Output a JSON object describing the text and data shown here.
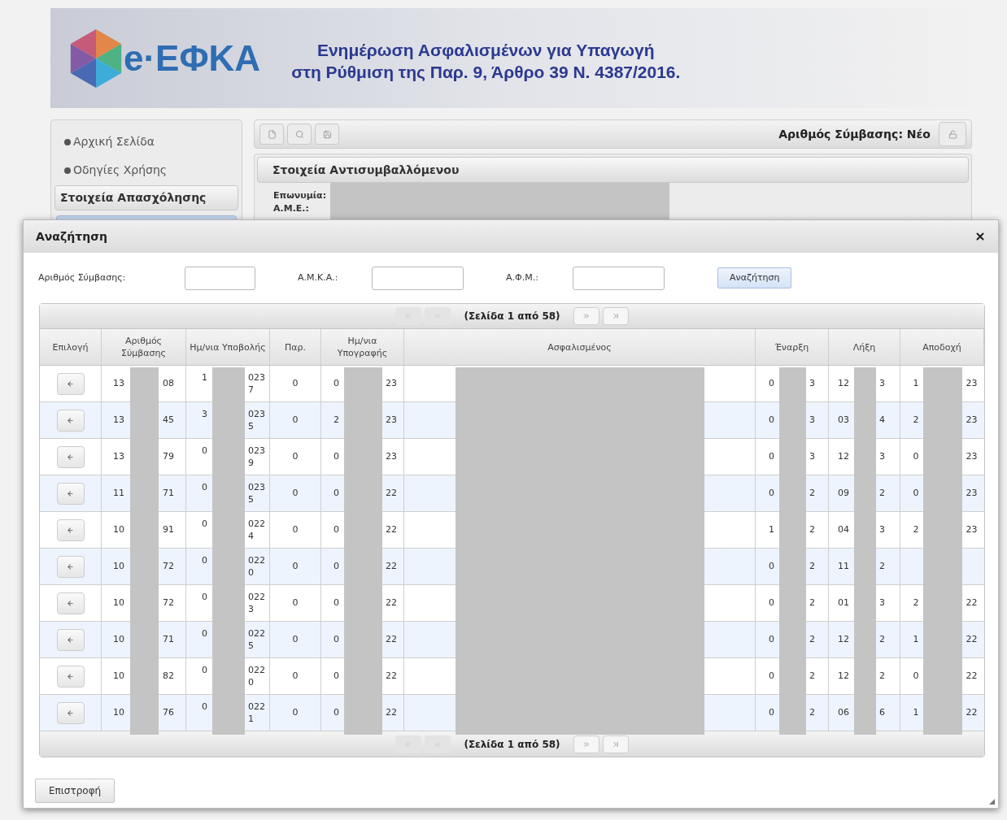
{
  "header": {
    "logo_text": "e·ΕΦΚΑ",
    "title_lines": [
      "Ενημέρωση Ασφαλισμένων για Υπαγωγή",
      "στη Ρύθμιση της Παρ. 9, Άρθρο 39 Ν. 4387/2016."
    ]
  },
  "sidebar": {
    "links": [
      "Αρχική Σελίδα",
      "Οδηγίες Χρήσης"
    ],
    "section": "Στοιχεία Απασχόλησης"
  },
  "toolbar": {
    "contract_label": "Αριθμός Σύμβασης: Νέο"
  },
  "contractor_panel": {
    "title": "Στοιχεία Αντισυμβαλλόμενου",
    "fields": [
      "Επωνυμία:",
      "Α.Μ.Ε.:"
    ]
  },
  "dialog": {
    "title": "Αναζήτηση",
    "filters": [
      {
        "label": "Αριθμός Σύμβασης:"
      },
      {
        "label": "Α.Μ.Κ.Α.:"
      },
      {
        "label": "Α.Φ.Μ.:"
      }
    ],
    "search_button": "Αναζήτηση",
    "pager_top": {
      "label": "(Σελίδα 1 από 58)",
      "buttons": [
        {
          "kind": "first",
          "disabled": true
        },
        {
          "kind": "prev",
          "disabled": true
        },
        {
          "kind": "next",
          "disabled": false
        },
        {
          "kind": "last",
          "disabled": false
        }
      ]
    },
    "columns": [
      "Επιλογή",
      "Αριθμός Σύμβασης",
      "Ημ/νια Υποβολής",
      "Παρ.",
      "Ημ/νια Υπογραφής",
      "Ασφαλισμένος",
      "Έναρξη",
      "Λήξη",
      "Αποδοχή"
    ],
    "rows": [
      {
        "contract": [
          "13",
          "08"
        ],
        "submitted": {
          "line1": [
            "1",
            "023"
          ],
          "line2": "7"
        },
        "par": "0",
        "signed": [
          "0",
          "23"
        ],
        "start": [
          "0",
          "3"
        ],
        "end": [
          "12",
          "3"
        ],
        "accepted": [
          "1",
          "23"
        ]
      },
      {
        "contract": [
          "13",
          "45"
        ],
        "submitted": {
          "line1": [
            "3",
            "023"
          ],
          "line2": "5"
        },
        "par": "0",
        "signed": [
          "2",
          "23"
        ],
        "start": [
          "0",
          "3"
        ],
        "end": [
          "03",
          "4"
        ],
        "accepted": [
          "2",
          "23"
        ]
      },
      {
        "contract": [
          "13",
          "79"
        ],
        "submitted": {
          "line1": [
            "0",
            "023"
          ],
          "line2": "9"
        },
        "par": "0",
        "signed": [
          "0",
          "23"
        ],
        "start": [
          "0",
          "3"
        ],
        "end": [
          "12",
          "3"
        ],
        "accepted": [
          "0",
          "23"
        ]
      },
      {
        "contract": [
          "11",
          "71"
        ],
        "submitted": {
          "line1": [
            "0",
            "023"
          ],
          "line2": "5"
        },
        "par": "0",
        "signed": [
          "0",
          "22"
        ],
        "start": [
          "0",
          "2"
        ],
        "end": [
          "09",
          "2"
        ],
        "accepted": [
          "0",
          "23"
        ]
      },
      {
        "contract": [
          "10",
          "91"
        ],
        "submitted": {
          "line1": [
            "0",
            "022"
          ],
          "line2": "4"
        },
        "par": "0",
        "signed": [
          "0",
          "22"
        ],
        "start": [
          "1",
          "2"
        ],
        "end": [
          "04",
          "3"
        ],
        "accepted": [
          "2",
          "23"
        ]
      },
      {
        "contract": [
          "10",
          "72"
        ],
        "submitted": {
          "line1": [
            "0",
            "022"
          ],
          "line2": "0"
        },
        "par": "0",
        "signed": [
          "0",
          "22"
        ],
        "start": [
          "0",
          "2"
        ],
        "end": [
          "11",
          "2"
        ]
      },
      {
        "contract": [
          "10",
          "72"
        ],
        "submitted": {
          "line1": [
            "0",
            "022"
          ],
          "line2": "3"
        },
        "par": "0",
        "signed": [
          "0",
          "22"
        ],
        "start": [
          "0",
          "2"
        ],
        "end": [
          "01",
          "3"
        ],
        "accepted": [
          "2",
          "22"
        ]
      },
      {
        "contract": [
          "10",
          "71"
        ],
        "submitted": {
          "line1": [
            "0",
            "022"
          ],
          "line2": "5"
        },
        "par": "0",
        "signed": [
          "0",
          "22"
        ],
        "start": [
          "0",
          "2"
        ],
        "end": [
          "12",
          "2"
        ],
        "accepted": [
          "1",
          "22"
        ]
      },
      {
        "contract": [
          "10",
          "82"
        ],
        "submitted": {
          "line1": [
            "0",
            "022"
          ],
          "line2": "0"
        },
        "par": "0",
        "signed": [
          "0",
          "22"
        ],
        "start": [
          "0",
          "2"
        ],
        "end": [
          "12",
          "2"
        ],
        "accepted": [
          "0",
          "22"
        ]
      },
      {
        "contract": [
          "10",
          "76"
        ],
        "submitted": {
          "line1": [
            "0",
            "022"
          ],
          "line2": "1"
        },
        "par": "0",
        "signed": [
          "0",
          "22"
        ],
        "start": [
          "0",
          "2"
        ],
        "end": [
          "06",
          "6"
        ],
        "accepted": [
          "1",
          "22"
        ]
      }
    ],
    "pager_bottom": {
      "label": "(Σελίδα 1 από 58)",
      "buttons": [
        {
          "kind": "first",
          "disabled": true
        },
        {
          "kind": "prev",
          "disabled": true
        },
        {
          "kind": "next",
          "disabled": false
        },
        {
          "kind": "last",
          "disabled": false
        }
      ]
    },
    "back_button": "Επιστροφή"
  }
}
